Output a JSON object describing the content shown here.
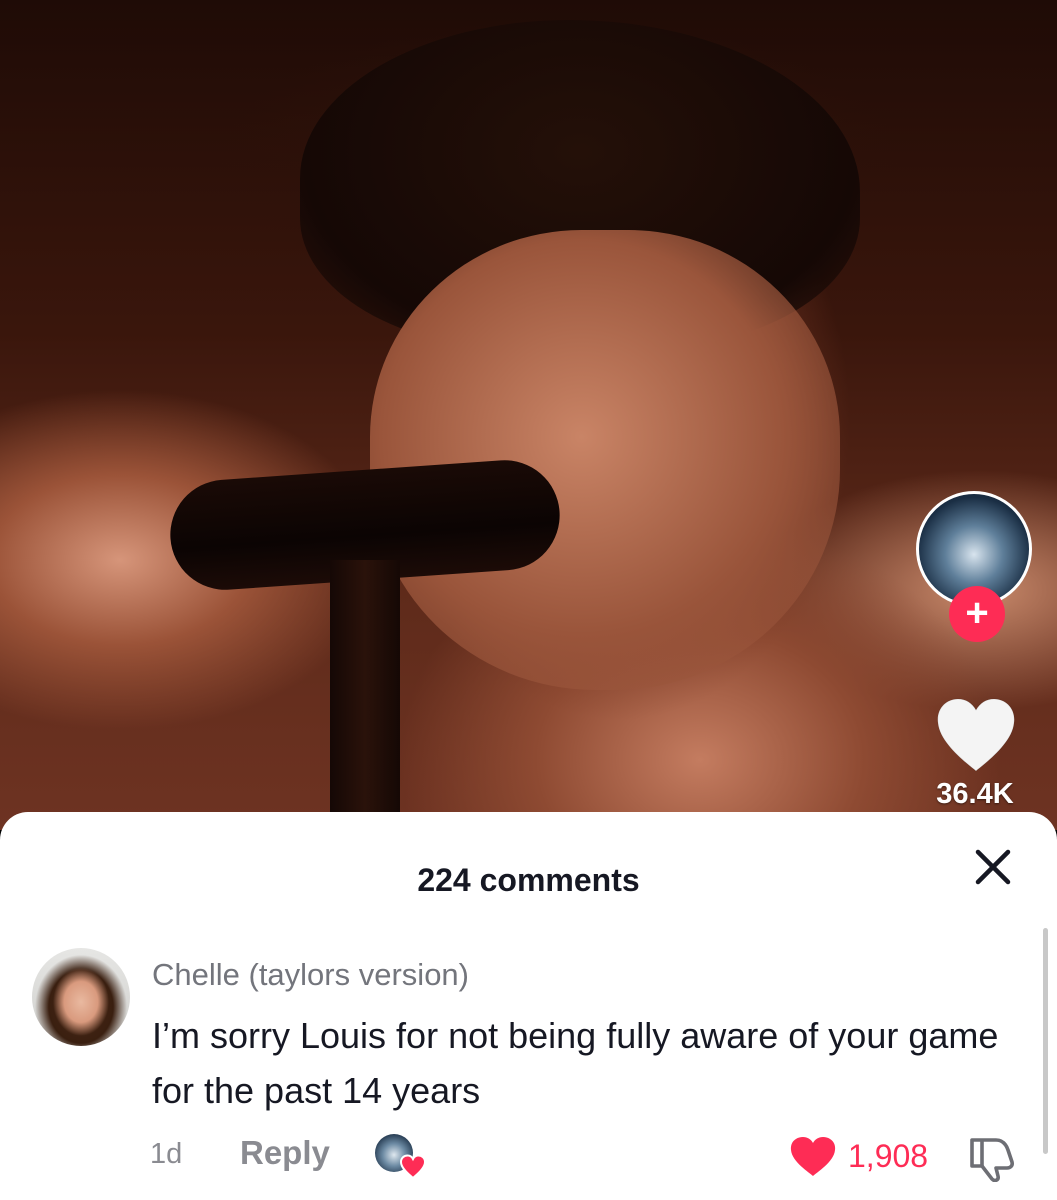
{
  "video": {
    "likes": "36.4K"
  },
  "creator": {
    "follow_label": "+"
  },
  "comments_sheet": {
    "title": "224 comments",
    "comments": [
      {
        "author": "Chelle (taylors version)",
        "text": "I’m sorry Louis for not being fully aware of your game for the past 14 years",
        "time": "1d",
        "reply_label": "Reply",
        "likes": "1,908",
        "liked_by_creator": true
      }
    ]
  },
  "colors": {
    "accent": "#fe2c55",
    "sheet_bg": "#ffffff",
    "text_primary": "#161823",
    "text_secondary": "#73757c"
  },
  "icons": [
    "close-icon",
    "heart-icon",
    "plus-icon",
    "dislike-icon"
  ]
}
